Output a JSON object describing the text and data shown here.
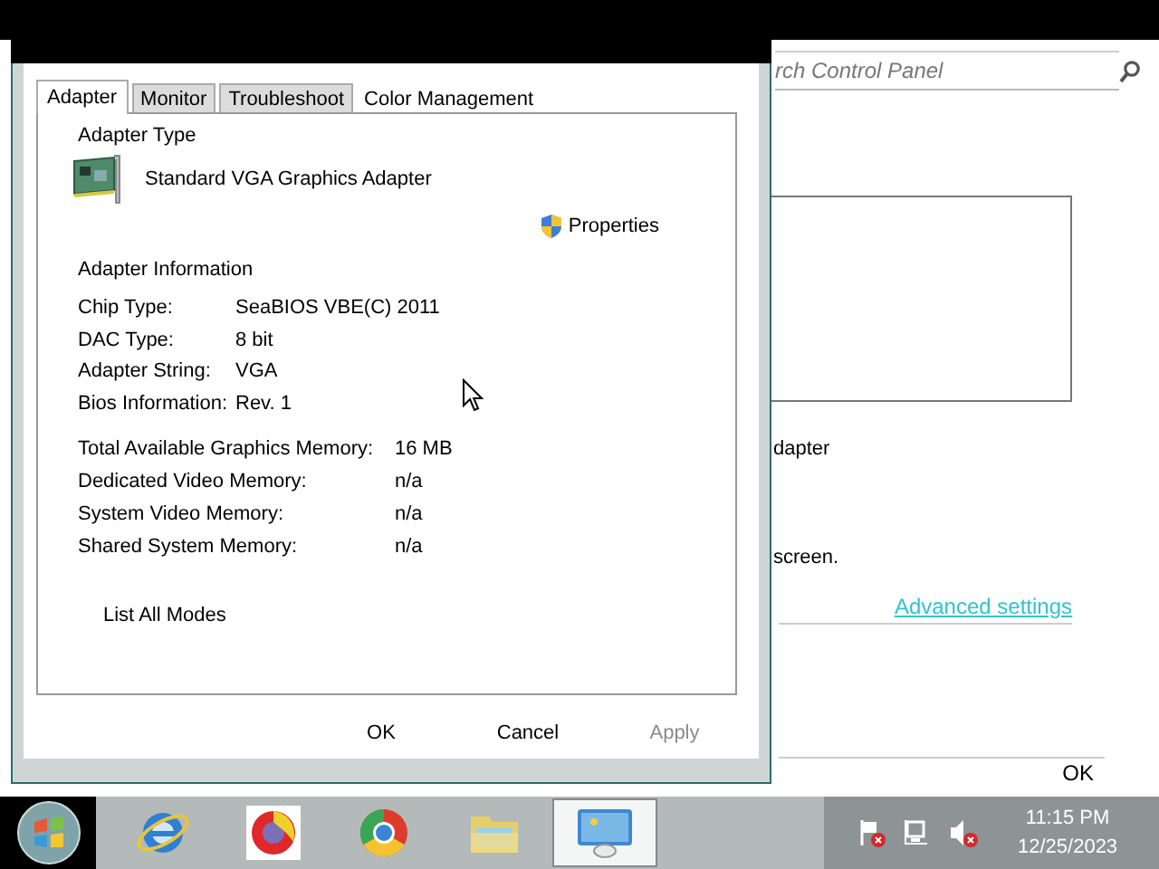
{
  "window": {
    "search": {
      "placeholder": "rch Control Panel"
    },
    "texts": [
      "dapter",
      "screen."
    ],
    "link": "Advanced settings",
    "ok_button": "OK"
  },
  "dialog": {
    "tabs": [
      {
        "label": "Adapter",
        "selected": true
      },
      {
        "label": "Monitor",
        "selected": false
      },
      {
        "label": "Troubleshoot",
        "selected": false
      },
      {
        "label": "Color Management",
        "selected": false
      }
    ],
    "adapter_type": {
      "heading": "Adapter Type",
      "name": "Standard VGA Graphics Adapter",
      "properties_button": "Properties"
    },
    "adapter_information": {
      "heading": "Adapter Information",
      "rows": [
        {
          "label": "Chip Type:",
          "value": "SeaBIOS VBE(C) 2011"
        },
        {
          "label": "DAC Type:",
          "value": "8 bit"
        },
        {
          "label": "Adapter String:",
          "value": "VGA"
        },
        {
          "label": "Bios Information:",
          "value": "Rev. 1"
        }
      ]
    },
    "memory": [
      {
        "label": "Total Available Graphics Memory:",
        "value": "16 MB"
      },
      {
        "label": "Dedicated Video Memory:",
        "value": "n/a"
      },
      {
        "label": "System Video Memory:",
        "value": "n/a"
      },
      {
        "label": "Shared System Memory:",
        "value": "n/a"
      }
    ],
    "list_modes_button": "List All Modes",
    "buttons": [
      {
        "label": "OK",
        "disabled": false
      },
      {
        "label": "Cancel",
        "disabled": false
      },
      {
        "label": "Apply",
        "disabled": true
      }
    ]
  },
  "taskbar": {
    "apps": [
      {
        "kind": "ie",
        "selected": false
      },
      {
        "kind": "firefox",
        "selected": false
      },
      {
        "kind": "chrome",
        "selected": false
      },
      {
        "kind": "explorer",
        "selected": false
      },
      {
        "kind": "display",
        "selected": true
      }
    ],
    "clock": {
      "time": "11:15 PM",
      "date": "12/25/2023"
    }
  }
}
